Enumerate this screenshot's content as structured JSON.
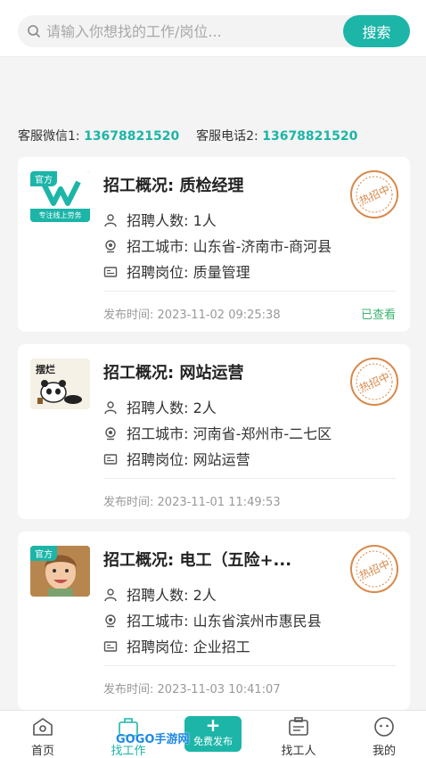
{
  "search": {
    "placeholder": "请输入你想找的工作/岗位...",
    "button_label": "搜索"
  },
  "contact": {
    "wechat_label": "客服微信1:",
    "wechat_value": "13678821520",
    "phone_label": "客服电话2:",
    "phone_value": "13678821520"
  },
  "labels": {
    "count": "招聘人数:",
    "city": "招工城市:",
    "position": "招聘岗位:",
    "posted": "发布时间:",
    "stamp": "热招中"
  },
  "jobs": [
    {
      "official_tag": "官方",
      "logo_text": "专注线上劳务",
      "title": "招工概况:  质检经理",
      "count": "1人",
      "city": "山东省-济南市-商河县",
      "position": "质量管理",
      "posted_time": "2023-11-02 09:25:38",
      "status": "已查看"
    },
    {
      "logo_text": "摆烂",
      "title": "招工概况:  网站运营",
      "count": "2人",
      "city": "河南省-郑州市-二七区",
      "position": "网站运营",
      "posted_time": "2023-11-01 11:49:53"
    },
    {
      "official_tag": "官方",
      "title": "招工概况:  电工（五险+...",
      "count": "2人",
      "city": "山东省滨州市惠民县",
      "position": "企业招工",
      "posted_time": "2023-11-03 10:41:07"
    }
  ],
  "nav": {
    "home": "首页",
    "find_job": "找工作",
    "publish": "免费发布",
    "find_worker": "找工人",
    "mine": "我的"
  },
  "watermark": "GOGO手游网",
  "colors": {
    "accent": "#1cb5a8",
    "stamp": "#d9894a",
    "viewed": "#3cb371"
  }
}
